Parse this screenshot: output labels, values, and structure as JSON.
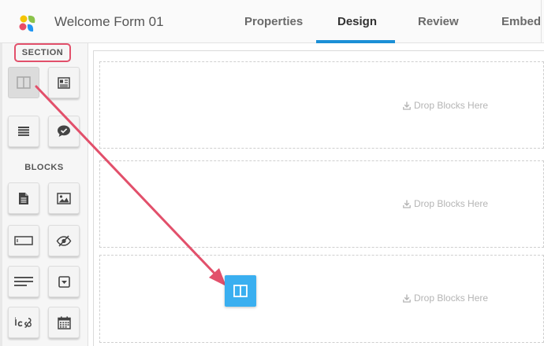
{
  "header": {
    "form_title": "Welcome Form 01",
    "tabs": [
      {
        "label": "Properties",
        "active": false
      },
      {
        "label": "Design",
        "active": true
      },
      {
        "label": "Review",
        "active": false
      },
      {
        "label": "Embed",
        "active": false
      }
    ]
  },
  "sidebar": {
    "section_heading": "SECTION",
    "blocks_heading": "BLOCKS",
    "section_tools": [
      "two-column-layout-icon",
      "newspaper-icon",
      "list-lines-icon",
      "chat-check-icon"
    ],
    "block_tools": [
      "document-icon",
      "image-icon",
      "text-field-icon",
      "eye-slash-icon",
      "paragraph-icon",
      "dropdown-icon",
      "signature-icon",
      "calendar-icon"
    ]
  },
  "canvas": {
    "dropzones": [
      {
        "label": "Drop Blocks Here"
      },
      {
        "label": "Drop Blocks Here"
      },
      {
        "label": "Drop Blocks Here"
      }
    ]
  },
  "colors": {
    "accent": "#1b8fd6",
    "highlight_border": "#e2506b",
    "arrow": "#e2506b",
    "drag_ghost": "#3aaff0"
  }
}
